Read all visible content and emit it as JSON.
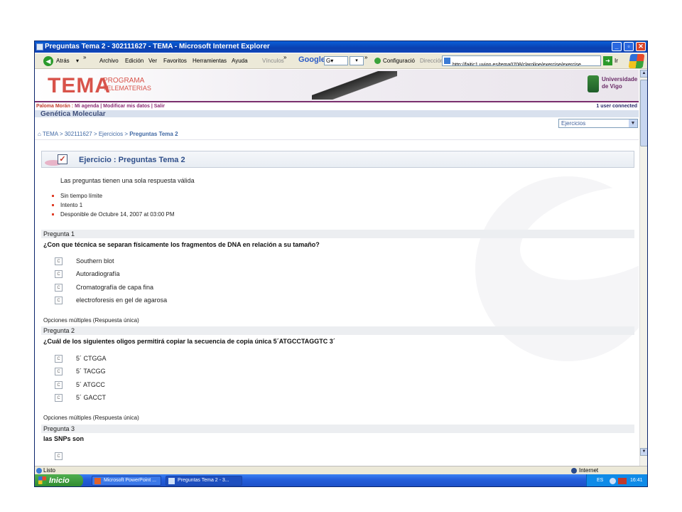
{
  "window": {
    "title": "Preguntas Tema 2 - 302111627 - TEMA - Microsoft Internet Explorer",
    "controls": {
      "minimize": "_",
      "restore": "▫",
      "close": "✕"
    }
  },
  "toolbar": {
    "back_label": "Atrás",
    "menu": [
      "Archivo",
      "Edición",
      "Ver",
      "Favoritos",
      "Herramientas",
      "Ayuda"
    ],
    "links_label": "Vínculos",
    "google_logo": "Google",
    "google_search": "G▾",
    "configure_label": "Configuració",
    "address_label": "Dirección",
    "address_value": "http://faitic1.uvigo.es/tema0708/claroline/exercise/exercise",
    "go_label": "Ir",
    "chevron": "»"
  },
  "banner": {
    "logo": "TEMA",
    "program_line1": "PROGRAMA",
    "program_line2": "TELEMATERIAS",
    "university_line1": "Universidade",
    "university_line2": "de Vigo"
  },
  "userbar": {
    "user": "Paloma Morán :",
    "links": "Mi agenda | Modificar mis datos | Salir",
    "connected": "1 user connected"
  },
  "course": {
    "title": "Genética Molecular",
    "tool_select": "Ejercicios"
  },
  "breadcrumb": {
    "home": "TEMA",
    "course": "302111627",
    "section": "Ejercicios",
    "current": "Preguntas Tema 2",
    "sep": ">"
  },
  "exercise": {
    "title": "Ejercicio : Preguntas Tema 2",
    "intro": "Las preguntas tienen una sola respuesta válida",
    "info": [
      "Sin tiempo límite",
      "Intento 1",
      "Desponible de Octubre 14, 2007 at 03:00 PM"
    ]
  },
  "questions": [
    {
      "header": "Pregunta 1",
      "text": "¿Con que técnica se separan físicamente los fragmentos de DNA en relación a su tamaño?",
      "options": [
        "Southern blot",
        "Autoradiografía",
        "Cromatografía de capa fina",
        "electroforesis en gel de agarosa"
      ],
      "type": "Opciones múltiples (Respuesta única)"
    },
    {
      "header": "Pregunta 2",
      "text": "¿Cuál de los siguientes oligos permitirá copiar la secuencia de copia única 5´ATGCCTAGGTC 3´",
      "options": [
        "5´ CTGGA",
        "5´ TACGG",
        "5´ ATGCC",
        "5´ GACCT"
      ],
      "type": "Opciones múltiples (Respuesta única)"
    },
    {
      "header": "Pregunta 3",
      "text": "las SNPs son",
      "options": [],
      "type": ""
    }
  ],
  "statusbar": {
    "left": "Listo",
    "zone": "Internet"
  },
  "taskbar": {
    "start": "Inicio",
    "tasks": [
      "Microsoft PowerPoint ...",
      "Preguntas Tema 2 - 3..."
    ],
    "lang": "ES",
    "clock": "16:41"
  },
  "radio_glyph": "C"
}
